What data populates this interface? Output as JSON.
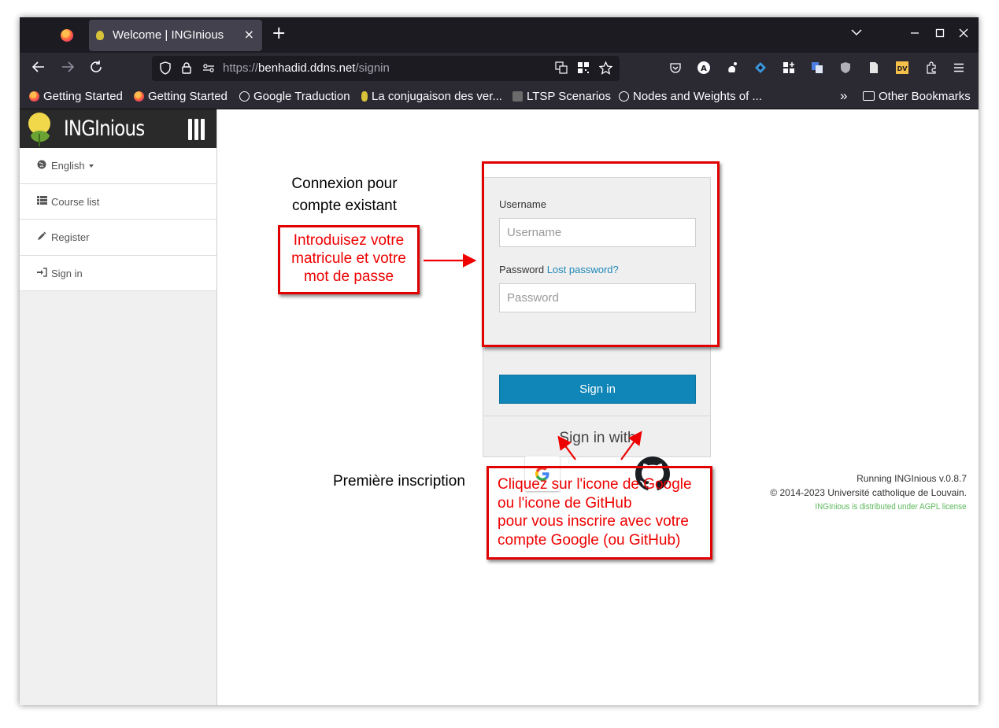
{
  "browser": {
    "tab_title": "Welcome | INGInious",
    "tab_close": "×",
    "new_tab": "+",
    "url_scheme": "https://",
    "url_host": "benhadid.ddns.net",
    "url_path": "/signin",
    "bookmarks": [
      {
        "label": "Getting Started",
        "icon": "firefox-icon"
      },
      {
        "label": "Getting Started",
        "icon": "firefox-icon"
      },
      {
        "label": "Google Traduction",
        "icon": "globe-icon"
      },
      {
        "label": "La conjugaison des ver...",
        "icon": "site-icon"
      },
      {
        "label": "LTSP Scenarios",
        "icon": "site-icon"
      },
      {
        "label": "Nodes and Weights of ...",
        "icon": "globe-icon"
      }
    ],
    "other_bookmarks": "Other Bookmarks"
  },
  "app": {
    "brand": "INGInious",
    "menu": [
      {
        "label": "English",
        "icon": "globe-icon"
      },
      {
        "label": "Course list",
        "icon": "list-icon"
      },
      {
        "label": "Register",
        "icon": "pencil-icon"
      },
      {
        "label": "Sign in",
        "icon": "sign-in-icon"
      }
    ]
  },
  "login": {
    "username_label": "Username",
    "username_placeholder": "Username",
    "password_label": "Password",
    "lost_password": "Lost password?",
    "password_placeholder": "Password",
    "signin_button": "Sign in",
    "signin_with": "Sign in with"
  },
  "footer": {
    "version": "Running INGInious v.0.8.7",
    "copyright": "© 2014-2023 Université catholique de Louvain.",
    "license": "INGInious is distributed under AGPL license"
  },
  "annotations": {
    "existing_1": "Connexion pour",
    "existing_2": "compte existant",
    "intro_1": "Introduisez votre",
    "intro_2": "matricule et votre",
    "intro_3": "mot de passe",
    "first_signup": "Première inscription",
    "click_1": "Cliquez sur l'icone de Google",
    "click_2": "ou l'icone de GitHub",
    "click_3": "pour vous inscrire avec votre",
    "click_4": "compte Google (ou GitHub)",
    "color": "#ee0000"
  }
}
